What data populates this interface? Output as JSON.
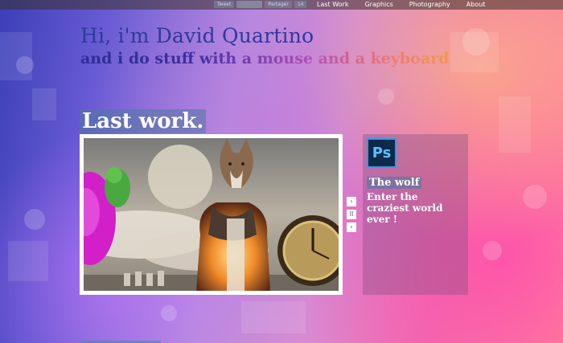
{
  "share": {
    "tweet_label": "Tweet",
    "facebook_label": "Partager",
    "count": "14"
  },
  "nav": {
    "items": [
      {
        "label": "Last Work"
      },
      {
        "label": "Graphics"
      },
      {
        "label": "Photography"
      },
      {
        "label": "About"
      }
    ]
  },
  "hero": {
    "headline": "Hi, i'm David Quartino",
    "subline": "and i do stuff with a mouse and a keyboard"
  },
  "section": {
    "title": "Last work."
  },
  "slideshow": {
    "controls": {
      "next": "›",
      "pause": "II",
      "prev": "‹"
    }
  },
  "info": {
    "icon_text": "Ps",
    "title": "The wolf",
    "description": "Enter the craziest world ever !"
  },
  "colors": {
    "headline": "#2e3a9a",
    "title_bg": "#5078a0",
    "ps_bg": "#0e2a4a",
    "ps_border": "#2f9ae8"
  }
}
